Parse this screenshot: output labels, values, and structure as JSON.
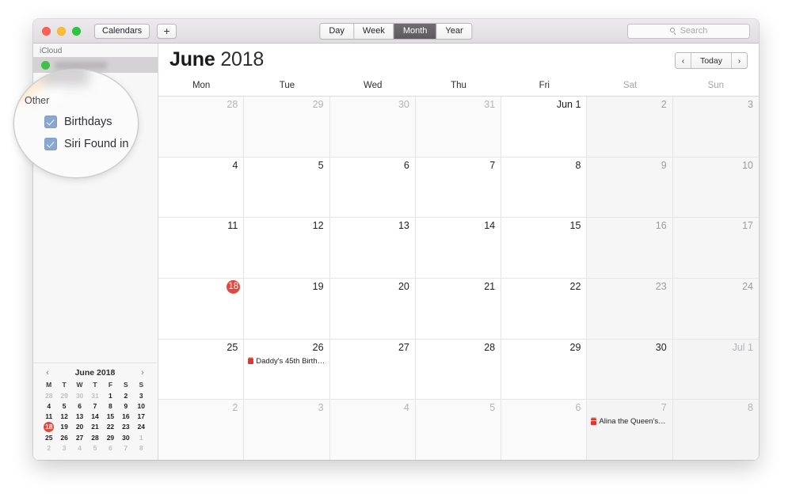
{
  "window": {
    "traffic_lights": [
      {
        "name": "close",
        "color": "#ff5f57"
      },
      {
        "name": "minimize",
        "color": "#febc2e"
      },
      {
        "name": "zoom",
        "color": "#28c840"
      }
    ],
    "calendars_button": "Calendars",
    "add_button": "+"
  },
  "toolbar": {
    "views": [
      {
        "label": "Day",
        "active": false
      },
      {
        "label": "Week",
        "active": false
      },
      {
        "label": "Month",
        "active": true
      },
      {
        "label": "Year",
        "active": false
      }
    ],
    "search": {
      "placeholder": "Search",
      "value": "",
      "icon": "search-icon"
    }
  },
  "sidebar": {
    "groups": [
      {
        "header": "iCloud",
        "items": [
          {
            "label": "",
            "redacted": true,
            "selected": true,
            "color": "#43c04a"
          },
          {
            "label": "",
            "redacted": true,
            "selected": false,
            "color": "#e8a33d"
          }
        ]
      }
    ],
    "magnifier": {
      "group_header": "Other",
      "items": [
        {
          "label": "Birthdays",
          "checked": true
        },
        {
          "label": "Siri Found in",
          "checked": true
        }
      ],
      "checkbox_color": "#8aa8cf"
    },
    "mini_calendar": {
      "title": "June 2018",
      "prev_label": "‹",
      "next_label": "›",
      "day_initials": [
        "M",
        "T",
        "W",
        "T",
        "F",
        "S",
        "S"
      ],
      "weeks": [
        [
          {
            "d": "28",
            "muted": true
          },
          {
            "d": "29",
            "muted": true
          },
          {
            "d": "30",
            "muted": true
          },
          {
            "d": "31",
            "muted": true
          },
          {
            "d": "1",
            "muted": false
          },
          {
            "d": "2",
            "muted": false
          },
          {
            "d": "3",
            "muted": false
          }
        ],
        [
          {
            "d": "4",
            "muted": false
          },
          {
            "d": "5",
            "muted": false
          },
          {
            "d": "6",
            "muted": false
          },
          {
            "d": "7",
            "muted": false
          },
          {
            "d": "8",
            "muted": false
          },
          {
            "d": "9",
            "muted": false
          },
          {
            "d": "10",
            "muted": false
          }
        ],
        [
          {
            "d": "11",
            "muted": false
          },
          {
            "d": "12",
            "muted": false
          },
          {
            "d": "13",
            "muted": false
          },
          {
            "d": "14",
            "muted": false
          },
          {
            "d": "15",
            "muted": false
          },
          {
            "d": "16",
            "muted": false
          },
          {
            "d": "17",
            "muted": false
          }
        ],
        [
          {
            "d": "18",
            "muted": false,
            "today": true
          },
          {
            "d": "19",
            "muted": false
          },
          {
            "d": "20",
            "muted": false
          },
          {
            "d": "21",
            "muted": false
          },
          {
            "d": "22",
            "muted": false
          },
          {
            "d": "23",
            "muted": false
          },
          {
            "d": "24",
            "muted": false
          }
        ],
        [
          {
            "d": "25",
            "muted": false
          },
          {
            "d": "26",
            "muted": false
          },
          {
            "d": "27",
            "muted": false
          },
          {
            "d": "28",
            "muted": false
          },
          {
            "d": "29",
            "muted": false
          },
          {
            "d": "30",
            "muted": false
          },
          {
            "d": "1",
            "muted": true
          }
        ],
        [
          {
            "d": "2",
            "muted": true
          },
          {
            "d": "3",
            "muted": true
          },
          {
            "d": "4",
            "muted": true
          },
          {
            "d": "5",
            "muted": true
          },
          {
            "d": "6",
            "muted": true
          },
          {
            "d": "7",
            "muted": true
          },
          {
            "d": "8",
            "muted": true
          }
        ]
      ],
      "today_color": "#e8453c"
    }
  },
  "main": {
    "month": "June",
    "year": "2018",
    "nav": {
      "prev": "‹",
      "today": "Today",
      "next": "›"
    },
    "day_headers": [
      {
        "label": "Mon",
        "weekend": false
      },
      {
        "label": "Tue",
        "weekend": false
      },
      {
        "label": "Wed",
        "weekend": false
      },
      {
        "label": "Thu",
        "weekend": false
      },
      {
        "label": "Fri",
        "weekend": false
      },
      {
        "label": "Sat",
        "weekend": true
      },
      {
        "label": "Sun",
        "weekend": true
      }
    ],
    "today_color": "#e8453c",
    "event_color": "#e0352c",
    "weeks": [
      [
        {
          "day": "28",
          "outside": true
        },
        {
          "day": "29",
          "outside": true
        },
        {
          "day": "30",
          "outside": true
        },
        {
          "day": "31",
          "outside": true
        },
        {
          "day": "Jun 1",
          "outside": false
        },
        {
          "day": "2",
          "outside": false,
          "weekend": true
        },
        {
          "day": "3",
          "outside": false,
          "weekend": true
        }
      ],
      [
        {
          "day": "4",
          "outside": false
        },
        {
          "day": "5",
          "outside": false
        },
        {
          "day": "6",
          "outside": false
        },
        {
          "day": "7",
          "outside": false
        },
        {
          "day": "8",
          "outside": false
        },
        {
          "day": "9",
          "outside": false,
          "weekend": true
        },
        {
          "day": "10",
          "outside": false,
          "weekend": true
        }
      ],
      [
        {
          "day": "11",
          "outside": false
        },
        {
          "day": "12",
          "outside": false
        },
        {
          "day": "13",
          "outside": false
        },
        {
          "day": "14",
          "outside": false
        },
        {
          "day": "15",
          "outside": false
        },
        {
          "day": "16",
          "outside": false,
          "weekend": true
        },
        {
          "day": "17",
          "outside": false,
          "weekend": true
        }
      ],
      [
        {
          "day": "18",
          "outside": false,
          "today": true
        },
        {
          "day": "19",
          "outside": false
        },
        {
          "day": "20",
          "outside": false
        },
        {
          "day": "21",
          "outside": false
        },
        {
          "day": "22",
          "outside": false
        },
        {
          "day": "23",
          "outside": false,
          "weekend": true
        },
        {
          "day": "24",
          "outside": false,
          "weekend": true
        }
      ],
      [
        {
          "day": "25",
          "outside": false
        },
        {
          "day": "26",
          "outside": false,
          "events": [
            {
              "title": "Daddy's 45th Birth…",
              "icon": "birthday-cake-icon"
            }
          ]
        },
        {
          "day": "27",
          "outside": false
        },
        {
          "day": "28",
          "outside": false
        },
        {
          "day": "29",
          "outside": false
        },
        {
          "day": "30",
          "outside": false,
          "weekend": true
        },
        {
          "day": "Jul 1",
          "outside": true,
          "weekend": true
        }
      ],
      [
        {
          "day": "2",
          "outside": true
        },
        {
          "day": "3",
          "outside": true
        },
        {
          "day": "4",
          "outside": true
        },
        {
          "day": "5",
          "outside": true
        },
        {
          "day": "6",
          "outside": true
        },
        {
          "day": "7",
          "outside": true,
          "weekend": true,
          "events": [
            {
              "title": "Alina the Queen's…",
              "icon": "birthday-cake-icon"
            }
          ]
        },
        {
          "day": "8",
          "outside": true,
          "weekend": true
        }
      ]
    ]
  }
}
